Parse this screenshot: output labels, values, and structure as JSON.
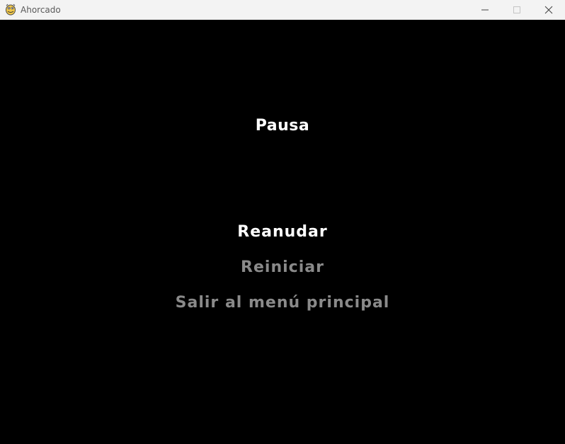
{
  "window": {
    "title": "Ahorcado",
    "icon": "pygame-snake-icon"
  },
  "pause_menu": {
    "title": "Pausa",
    "items": [
      {
        "label": "Reanudar",
        "selected": true
      },
      {
        "label": "Reiniciar",
        "selected": false
      },
      {
        "label": "Salir al menú principal",
        "selected": false
      }
    ]
  },
  "colors": {
    "background": "#000000",
    "title_text": "#ffffff",
    "selected_item": "#ffffff",
    "unselected_item": "#8a8a8a"
  }
}
